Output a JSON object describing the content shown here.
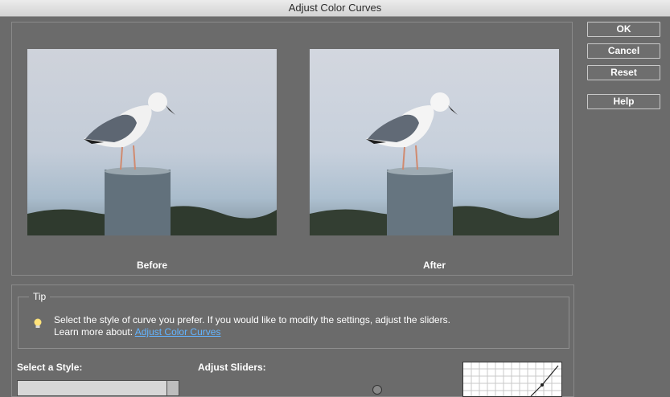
{
  "window": {
    "title": "Adjust Color Curves"
  },
  "preview": {
    "before_label": "Before",
    "after_label": "After"
  },
  "buttons": {
    "ok": "OK",
    "cancel": "Cancel",
    "reset": "Reset",
    "help": "Help"
  },
  "tip": {
    "legend": "Tip",
    "line1": "Select the style of curve you prefer. If you would like to modify the settings, adjust the sliders.",
    "line2_prefix": "Learn more about:",
    "link": "Adjust Color Curves"
  },
  "style_section": {
    "label": "Select a Style:"
  },
  "sliders_section": {
    "label": "Adjust Sliders:"
  },
  "icons": {
    "tip": "lightbulb-icon"
  }
}
